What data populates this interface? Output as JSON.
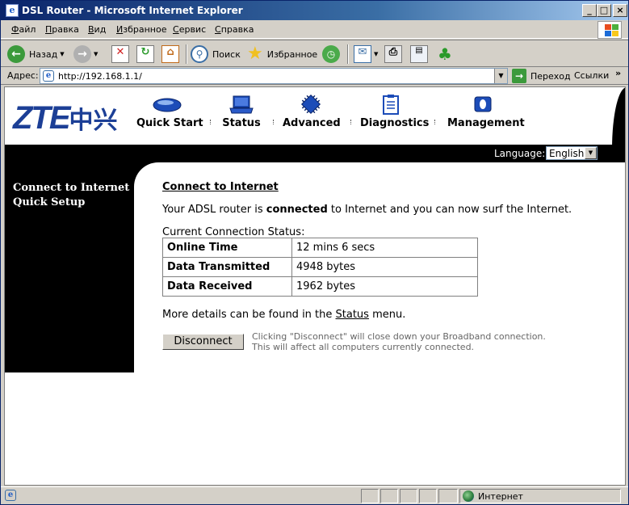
{
  "window": {
    "title": "DSL Router - Microsoft Internet Explorer",
    "controls": {
      "minimize": "_",
      "maximize": "□",
      "close": "×"
    }
  },
  "menu": [
    "Файл",
    "Правка",
    "Вид",
    "Избранное",
    "Сервис",
    "Справка"
  ],
  "toolbar": {
    "back": "Назад",
    "search": "Поиск",
    "favorites": "Избранное"
  },
  "address": {
    "label": "Адрес:",
    "url": "http://192.168.1.1/",
    "go": "Переход",
    "links": "Ссылки"
  },
  "router": {
    "brand": "ZTE",
    "brand_cn": "中兴",
    "nav": [
      {
        "label": "Quick Start",
        "icon": "mouse-icon"
      },
      {
        "label": "Status",
        "icon": "laptop-icon"
      },
      {
        "label": "Advanced",
        "icon": "chip-icon"
      },
      {
        "label": "Diagnostics",
        "icon": "clipboard-icon"
      },
      {
        "label": "Management",
        "icon": "tools-icon"
      }
    ],
    "language_label": "Language:",
    "language": "English",
    "sidebar": [
      "Connect to Internet",
      "Quick Setup"
    ]
  },
  "main": {
    "title": "Connect to Internet",
    "msg_prefix": "Your ADSL router is ",
    "msg_bold": "connected",
    "msg_suffix": " to Internet and you can now surf the Internet.",
    "table_caption": "Current Connection Status:",
    "rows": [
      {
        "key": "Online Time",
        "value": "12 mins 6 secs"
      },
      {
        "key": "Data Transmitted",
        "value": "4948 bytes"
      },
      {
        "key": "Data Received",
        "value": "1962 bytes"
      }
    ],
    "details_prefix": "More details can be found in the ",
    "details_link": "Status",
    "details_suffix": " menu.",
    "disconnect": "Disconnect",
    "note_line1": "Clicking \"Disconnect\" will close down your Broadband connection.",
    "note_line2": "This will affect all computers currently connected."
  },
  "statusbar": {
    "zone": "Интернет"
  }
}
